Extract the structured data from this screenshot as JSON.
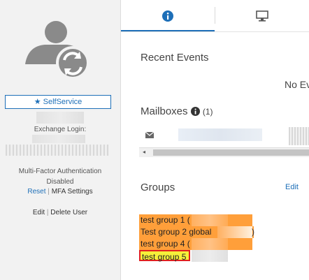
{
  "sidebar": {
    "self_service_label": "SelfService",
    "exchange_login_label": "Exchange Login:",
    "mfa_title": "Multi-Factor Authentication",
    "mfa_status": "Disabled",
    "reset_label": "Reset",
    "separator": "|",
    "mfa_settings_label": "MFA Settings",
    "edit_label": "Edit",
    "delete_user_label": "Delete User"
  },
  "tabs": [
    {
      "name": "info",
      "icon": "info-icon",
      "active": true
    },
    {
      "name": "desktop",
      "icon": "monitor-icon",
      "active": false
    }
  ],
  "recent_events": {
    "title": "Recent Events",
    "empty_text": "No Ev"
  },
  "mailboxes": {
    "title": "Mailboxes",
    "count_text": "(1)"
  },
  "groups": {
    "title": "Groups",
    "edit_label": "Edit",
    "items": [
      {
        "label": "test group 1 (",
        "suffix": ""
      },
      {
        "label": "Test group 2 global",
        "suffix": ")"
      },
      {
        "label": "test group 4 (",
        "suffix": ""
      },
      {
        "label": "test group 5",
        "suffix": ""
      }
    ]
  },
  "colors": {
    "accent": "#1d6fb8",
    "highlight_orange": "#ff9f3a",
    "highlight_yellow": "#f6f03a",
    "selection_border": "#e02020"
  }
}
